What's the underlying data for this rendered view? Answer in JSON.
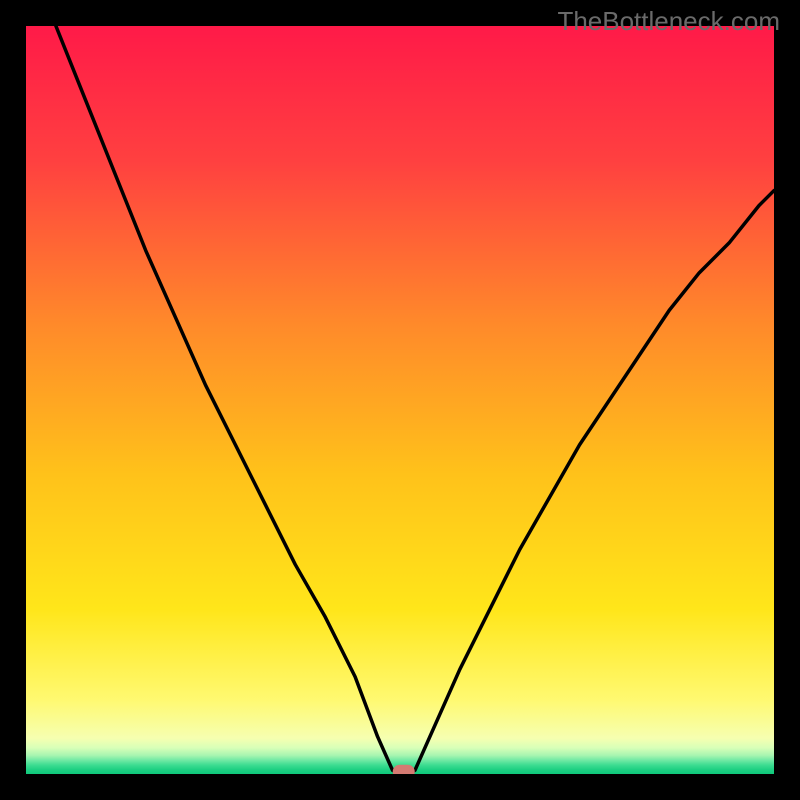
{
  "watermark": "TheBottleneck.com",
  "chart_data": {
    "type": "line",
    "title": "",
    "xlabel": "",
    "ylabel": "",
    "xlim": [
      0,
      100
    ],
    "ylim": [
      0,
      100
    ],
    "dip_x": 50,
    "curve": [
      {
        "x": 4,
        "y": 100
      },
      {
        "x": 8,
        "y": 90
      },
      {
        "x": 12,
        "y": 80
      },
      {
        "x": 16,
        "y": 70
      },
      {
        "x": 20,
        "y": 61
      },
      {
        "x": 24,
        "y": 52
      },
      {
        "x": 28,
        "y": 44
      },
      {
        "x": 32,
        "y": 36
      },
      {
        "x": 36,
        "y": 28
      },
      {
        "x": 40,
        "y": 21
      },
      {
        "x": 44,
        "y": 13
      },
      {
        "x": 47,
        "y": 5
      },
      {
        "x": 49,
        "y": 0.5
      },
      {
        "x": 50,
        "y": 0
      },
      {
        "x": 51,
        "y": 0
      },
      {
        "x": 52,
        "y": 0.5
      },
      {
        "x": 54,
        "y": 5
      },
      {
        "x": 58,
        "y": 14
      },
      {
        "x": 62,
        "y": 22
      },
      {
        "x": 66,
        "y": 30
      },
      {
        "x": 70,
        "y": 37
      },
      {
        "x": 74,
        "y": 44
      },
      {
        "x": 78,
        "y": 50
      },
      {
        "x": 82,
        "y": 56
      },
      {
        "x": 86,
        "y": 62
      },
      {
        "x": 90,
        "y": 67
      },
      {
        "x": 94,
        "y": 71
      },
      {
        "x": 98,
        "y": 76
      },
      {
        "x": 100,
        "y": 78
      }
    ],
    "gradient_stops": [
      {
        "offset": 0.0,
        "color": "#ff1a48"
      },
      {
        "offset": 0.18,
        "color": "#ff4040"
      },
      {
        "offset": 0.4,
        "color": "#ff8a2a"
      },
      {
        "offset": 0.6,
        "color": "#ffc21a"
      },
      {
        "offset": 0.78,
        "color": "#ffe61a"
      },
      {
        "offset": 0.9,
        "color": "#fff970"
      },
      {
        "offset": 0.952,
        "color": "#f6ffb0"
      },
      {
        "offset": 0.965,
        "color": "#d8ffb8"
      },
      {
        "offset": 0.975,
        "color": "#a8f5b0"
      },
      {
        "offset": 0.982,
        "color": "#6de8a3"
      },
      {
        "offset": 0.988,
        "color": "#3ddc91"
      },
      {
        "offset": 0.994,
        "color": "#1fd083"
      },
      {
        "offset": 1.0,
        "color": "#0fc97b"
      }
    ],
    "marker": {
      "x": 50.5,
      "y": 0.3,
      "color": "#d47a72"
    },
    "frame_color": "#000000",
    "curve_color": "#000000"
  }
}
